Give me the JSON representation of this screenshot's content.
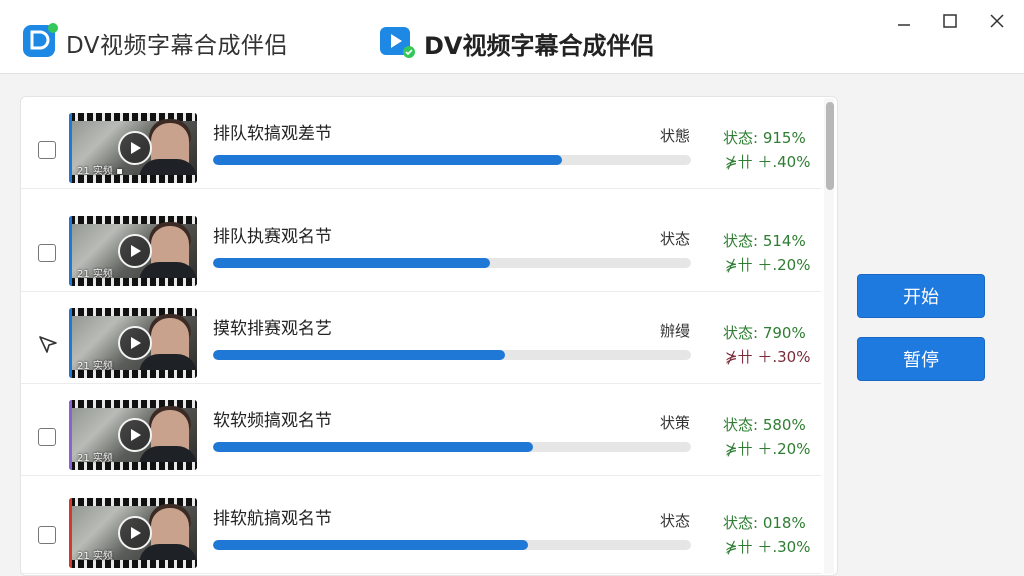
{
  "window": {
    "title": "DV视频字幕合成伴侣",
    "center_title": "DV视频字幕合成伴侣"
  },
  "colors": {
    "accent": "#1f77d6",
    "stat_green": "#2e7d32",
    "stat_dark": "#7a2a3a"
  },
  "tasks": [
    {
      "name": "排队软搞观差节",
      "status_word": "状態",
      "stat1": "状态: 915%",
      "stat2": "⋡卄 ＋.40%",
      "progress": 0.73,
      "thumb_caption": "21 实频 ▪",
      "checked": false,
      "accent": "#1f77d6"
    },
    {
      "name": "排队执赛观名节",
      "status_word": "状态",
      "stat1": "状态: 514%",
      "stat2": "⋡卄 ＋.20%",
      "progress": 0.58,
      "thumb_caption": "21 实频",
      "checked": false,
      "accent": "#1f77d6"
    },
    {
      "name": "摸软排赛观名艺",
      "status_word": "辦缦",
      "stat1": "状态: 790%",
      "stat2": "⋡卄 ＋.30%",
      "progress": 0.61,
      "thumb_caption": "21 实频",
      "checked": true,
      "accent": "#1f77d6"
    },
    {
      "name": "软软频搞观名节",
      "status_word": "状策",
      "stat1": "状态: 580%",
      "stat2": "⋡卄 ＋.20%",
      "progress": 0.67,
      "thumb_caption": "21 实频",
      "checked": false,
      "accent": "#8a63d2"
    },
    {
      "name": "排软航搞观名节",
      "status_word": "状态",
      "stat1": "状态: 018%",
      "stat2": "⋡卄 ＋.30%",
      "progress": 0.66,
      "thumb_caption": "21 实频",
      "checked": false,
      "accent": "#d33a2c"
    }
  ],
  "actions": {
    "start_label": "开始",
    "pause_label": "暂停"
  }
}
